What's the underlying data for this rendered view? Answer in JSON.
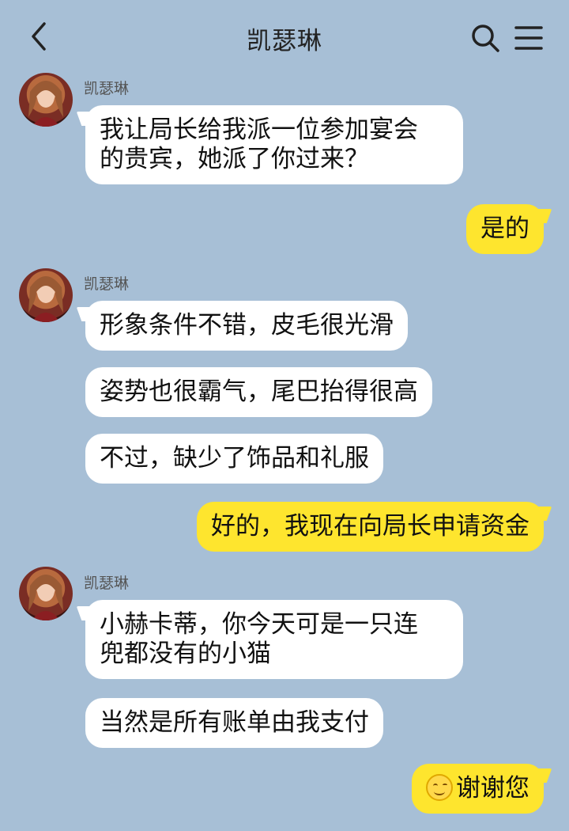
{
  "header": {
    "title": "凯瑟琳",
    "back_icon": "chevron-left-icon",
    "search_icon": "search-icon",
    "menu_icon": "menu-icon"
  },
  "colors": {
    "background": "#a7bfd6",
    "incoming_bubble": "#ffffff",
    "outgoing_bubble": "#fee52e"
  },
  "messages": [
    {
      "sender": "凯瑟琳",
      "text_line1": "我让局长给我派一位参加宴会",
      "text_line2": "的贵宾，她派了你过来？"
    },
    {
      "text": "是的"
    },
    {
      "sender": "凯瑟琳",
      "text": "形象条件不错，皮毛很光滑"
    },
    {
      "text": "姿势也很霸气，尾巴抬得很高"
    },
    {
      "text": "不过，缺少了饰品和礼服"
    },
    {
      "text": "好的，我现在向局长申请资金"
    },
    {
      "sender": "凯瑟琳",
      "text_line1": "小赫卡蒂，你今天可是一只连",
      "text_line2": "兜都没有的小猫"
    },
    {
      "text": "当然是所有账单由我支付"
    },
    {
      "emoji": "smiling-face-emoji",
      "text": "谢谢您"
    }
  ]
}
